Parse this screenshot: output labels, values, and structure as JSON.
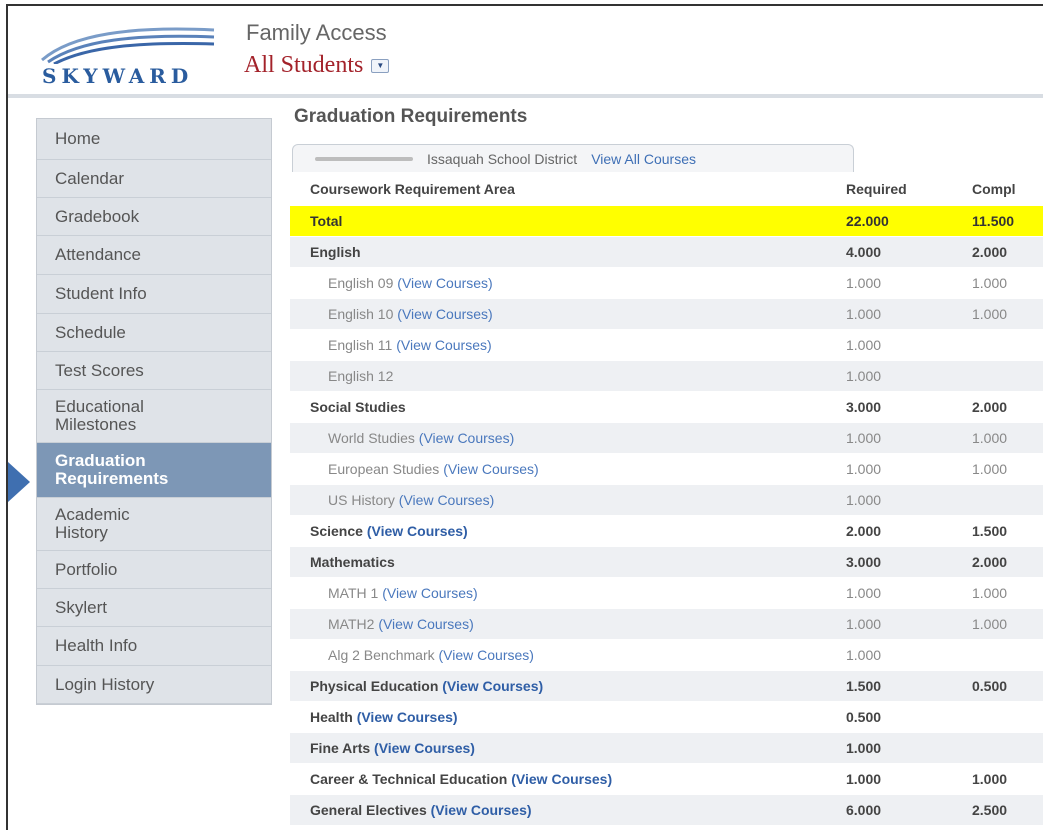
{
  "header": {
    "logo_text": "SKYWARD",
    "app_title": "Family Access",
    "student_select": "All Students",
    "dropdown_icon": "chevron-down-icon"
  },
  "sidebar": {
    "items": [
      {
        "label": "Home"
      },
      {
        "label": "Calendar"
      },
      {
        "label": "Gradebook"
      },
      {
        "label": "Attendance"
      },
      {
        "label": "Student Info"
      },
      {
        "label": "Schedule"
      },
      {
        "label": "Test Scores"
      },
      {
        "label": "Educational\nMilestones"
      },
      {
        "label": "Graduation\nRequirements",
        "active": true
      },
      {
        "label": "Academic\nHistory"
      },
      {
        "label": "Portfolio"
      },
      {
        "label": "Skylert"
      },
      {
        "label": "Health Info"
      },
      {
        "label": "Login History"
      }
    ]
  },
  "main": {
    "title": "Graduation Requirements",
    "tab": {
      "district": "Issaquah School District",
      "link": "View All Courses"
    },
    "columns": [
      "Coursework Requirement Area",
      "Required",
      "Compl"
    ],
    "rows": [
      {
        "area": "Total",
        "link": "",
        "required": "22.000",
        "completed": "11.500",
        "style": "total"
      },
      {
        "area": "English",
        "link": "",
        "required": "4.000",
        "completed": "2.000",
        "style": "bold"
      },
      {
        "area": "English 09",
        "link": "(View Courses)",
        "required": "1.000",
        "completed": "1.000",
        "style": "sub"
      },
      {
        "area": "English 10",
        "link": "(View Courses)",
        "required": "1.000",
        "completed": "1.000",
        "style": "sub"
      },
      {
        "area": "English 11",
        "link": "(View Courses)",
        "required": "1.000",
        "completed": "",
        "style": "sub"
      },
      {
        "area": "English 12",
        "link": "",
        "required": "1.000",
        "completed": "",
        "style": "sub"
      },
      {
        "area": "Social Studies",
        "link": "",
        "required": "3.000",
        "completed": "2.000",
        "style": "bold"
      },
      {
        "area": "World Studies",
        "link": "(View Courses)",
        "required": "1.000",
        "completed": "1.000",
        "style": "sub"
      },
      {
        "area": "European Studies",
        "link": "(View Courses)",
        "required": "1.000",
        "completed": "1.000",
        "style": "sub"
      },
      {
        "area": "US History",
        "link": "(View Courses)",
        "required": "1.000",
        "completed": "",
        "style": "sub"
      },
      {
        "area": "Science",
        "link": "(View Courses)",
        "required": "2.000",
        "completed": "1.500",
        "style": "bold"
      },
      {
        "area": "Mathematics",
        "link": "",
        "required": "3.000",
        "completed": "2.000",
        "style": "bold"
      },
      {
        "area": "MATH 1",
        "link": "(View Courses)",
        "required": "1.000",
        "completed": "1.000",
        "style": "sub"
      },
      {
        "area": "MATH2",
        "link": "(View Courses)",
        "required": "1.000",
        "completed": "1.000",
        "style": "sub"
      },
      {
        "area": "Alg 2 Benchmark",
        "link": "(View Courses)",
        "required": "1.000",
        "completed": "",
        "style": "sub"
      },
      {
        "area": "Physical Education",
        "link": "(View Courses)",
        "required": "1.500",
        "completed": "0.500",
        "style": "bold"
      },
      {
        "area": "Health",
        "link": "(View Courses)",
        "required": "0.500",
        "completed": "",
        "style": "bold"
      },
      {
        "area": "Fine Arts",
        "link": "(View Courses)",
        "required": "1.000",
        "completed": "",
        "style": "bold"
      },
      {
        "area": "Career & Technical Education",
        "link": "(View Courses)",
        "required": "1.000",
        "completed": "1.000",
        "style": "bold"
      },
      {
        "area": "General Electives",
        "link": "(View Courses)",
        "required": "6.000",
        "completed": "2.500",
        "style": "bold"
      }
    ]
  },
  "colors": {
    "accent": "#3f6fb0",
    "active_nav": "#7d97b6",
    "total_highlight": "#ffff00",
    "student_name": "#a3222a",
    "link": "#4a78bd"
  }
}
